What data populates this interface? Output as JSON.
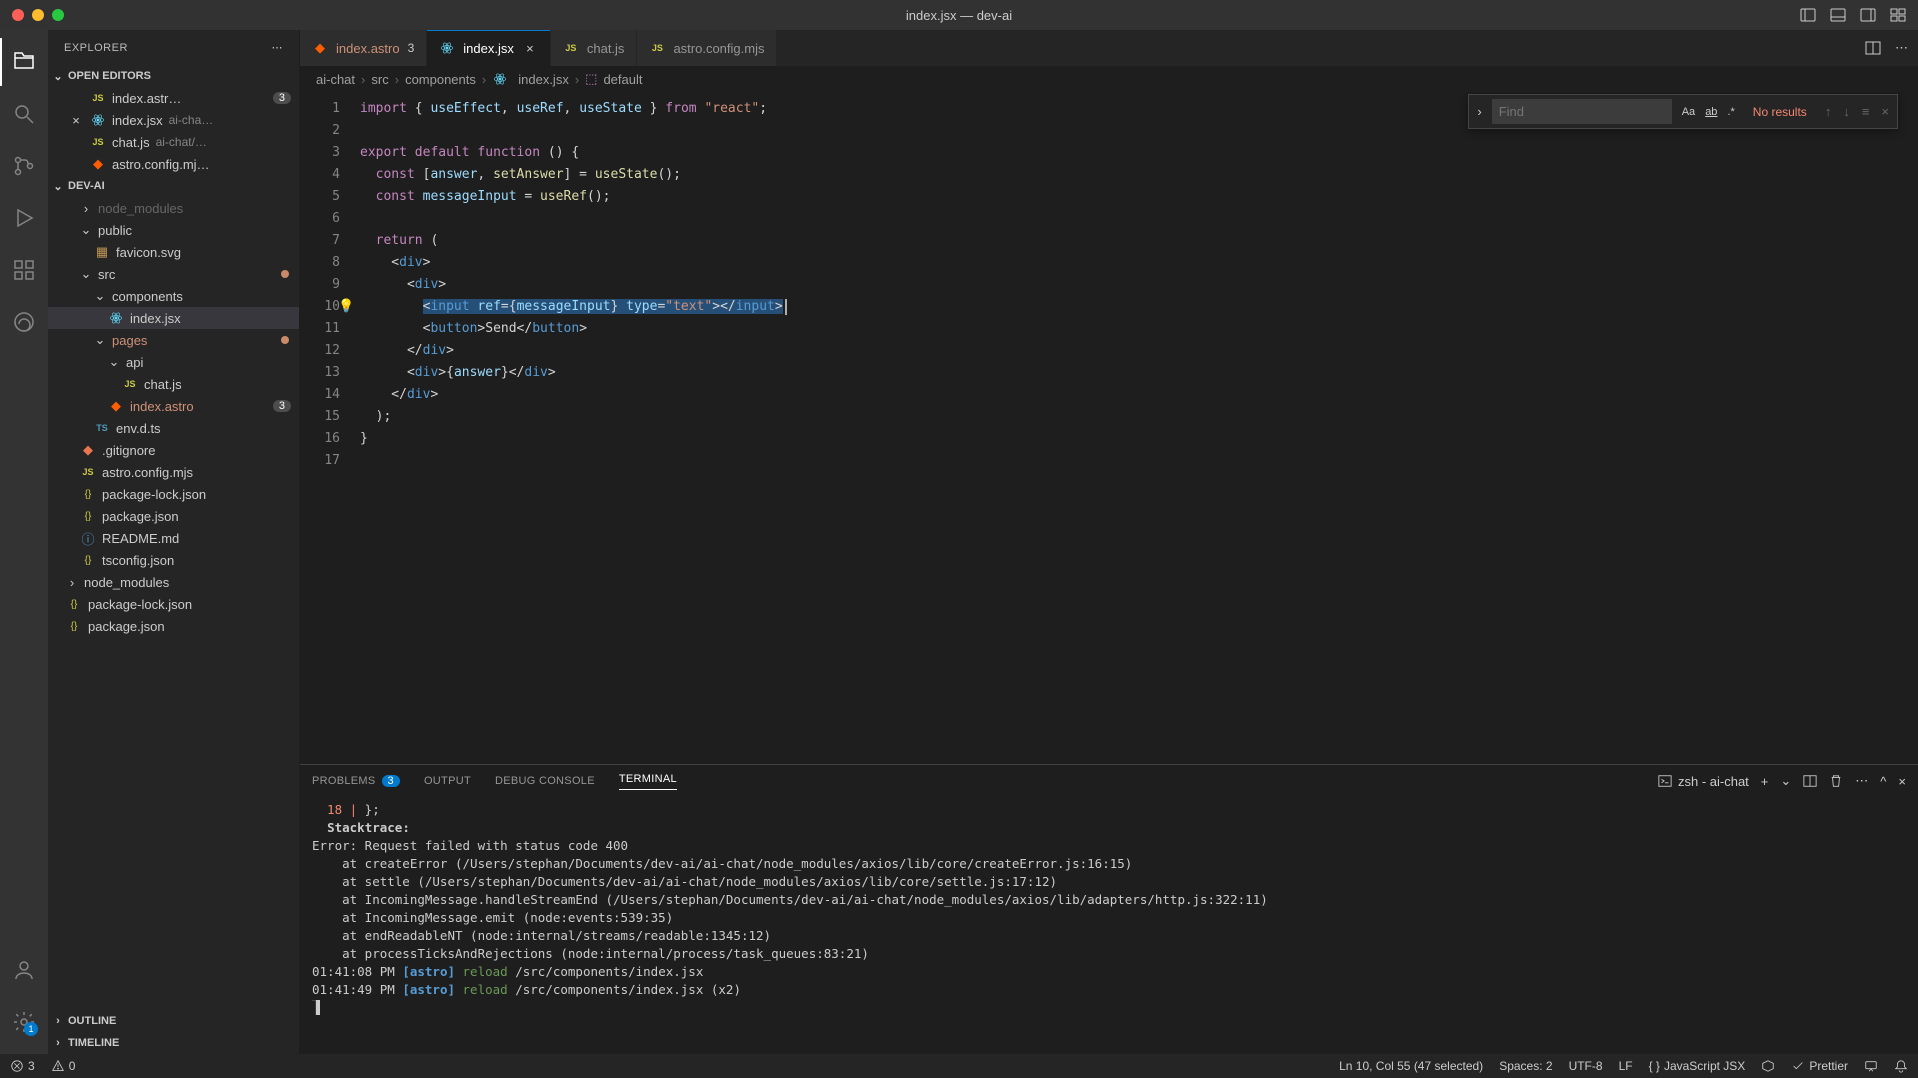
{
  "window": {
    "title": "index.jsx — dev-ai"
  },
  "sidebar": {
    "title": "EXPLORER",
    "sections": {
      "open_editors": "OPEN EDITORS",
      "project": "DEV-AI",
      "outline": "OUTLINE",
      "timeline": "TIMELINE"
    }
  },
  "open_editors": [
    {
      "name": "index.astr…",
      "badge": "3",
      "suffix": ""
    },
    {
      "name": "index.jsx",
      "suffix": "ai-cha…",
      "active": true
    },
    {
      "name": "chat.js",
      "suffix": "ai-chat/…"
    },
    {
      "name": "astro.config.mj…",
      "suffix": ""
    }
  ],
  "tree": [
    {
      "label": "node_modules",
      "indent": 1,
      "folder": true,
      "dim": true
    },
    {
      "label": "public",
      "indent": 1,
      "folder": true,
      "open": true
    },
    {
      "label": "favicon.svg",
      "indent": 2,
      "icon": "svg"
    },
    {
      "label": "src",
      "indent": 1,
      "folder": true,
      "open": true,
      "mod": true
    },
    {
      "label": "components",
      "indent": 2,
      "folder": true,
      "open": true
    },
    {
      "label": "index.jsx",
      "indent": 3,
      "icon": "react",
      "selected": true
    },
    {
      "label": "pages",
      "indent": 2,
      "folder": true,
      "open": true,
      "mod": true,
      "orange": true
    },
    {
      "label": "api",
      "indent": 3,
      "folder": true,
      "open": true
    },
    {
      "label": "chat.js",
      "indent": 4,
      "icon": "js"
    },
    {
      "label": "index.astro",
      "indent": 3,
      "icon": "astro",
      "badge": "3",
      "orange": true
    },
    {
      "label": "env.d.ts",
      "indent": 2,
      "icon": "ts"
    },
    {
      "label": ".gitignore",
      "indent": 1,
      "icon": "git"
    },
    {
      "label": "astro.config.mjs",
      "indent": 1,
      "icon": "js"
    },
    {
      "label": "package-lock.json",
      "indent": 1,
      "icon": "json"
    },
    {
      "label": "package.json",
      "indent": 1,
      "icon": "json"
    },
    {
      "label": "README.md",
      "indent": 1,
      "icon": "md"
    },
    {
      "label": "tsconfig.json",
      "indent": 1,
      "icon": "json"
    },
    {
      "label": "node_modules",
      "indent": 0,
      "folder": true
    },
    {
      "label": "package-lock.json",
      "indent": 0,
      "icon": "json"
    },
    {
      "label": "package.json",
      "indent": 0,
      "icon": "json"
    }
  ],
  "tabs": [
    {
      "label": "index.astro",
      "icon": "astro",
      "badge": "3"
    },
    {
      "label": "index.jsx",
      "icon": "react",
      "active": true,
      "close": "×"
    },
    {
      "label": "chat.js",
      "icon": "js"
    },
    {
      "label": "astro.config.mjs",
      "icon": "js"
    }
  ],
  "breadcrumbs": [
    "ai-chat",
    "src",
    "components",
    "index.jsx",
    "default"
  ],
  "find": {
    "placeholder": "Find",
    "results": "No results"
  },
  "code": {
    "lines": 17,
    "content": {
      "l1": "import { useEffect, useRef, useState } from \"react\";",
      "l2": "",
      "l3": "export default function () {",
      "l4": "  const [answer, setAnswer] = useState();",
      "l5": "  const messageInput = useRef();",
      "l6": "",
      "l7": "  return (",
      "l8": "    <div>",
      "l9": "      <div>",
      "l10_pre": "        ",
      "l10_sel": "<input ref={messageInput} type=\"text\"></input>",
      "l11": "        <button>Send</button>",
      "l12": "      </div>",
      "l13": "      <div>{answer}</div>",
      "l14": "    </div>",
      "l15": "  );",
      "l16": "}",
      "l17": ""
    }
  },
  "panel": {
    "tabs": {
      "problems": "PROBLEMS",
      "problems_badge": "3",
      "output": "OUTPUT",
      "debug": "DEBUG CONSOLE",
      "terminal": "TERMINAL"
    },
    "shell": "zsh - ai-chat"
  },
  "terminal": {
    "lines": [
      "  18 | };",
      "  Stacktrace:",
      "Error: Request failed with status code 400",
      "    at createError (/Users/stephan/Documents/dev-ai/ai-chat/node_modules/axios/lib/core/createError.js:16:15)",
      "    at settle (/Users/stephan/Documents/dev-ai/ai-chat/node_modules/axios/lib/core/settle.js:17:12)",
      "    at IncomingMessage.handleStreamEnd (/Users/stephan/Documents/dev-ai/ai-chat/node_modules/axios/lib/adapters/http.js:322:11)",
      "    at IncomingMessage.emit (node:events:539:35)",
      "    at endReadableNT (node:internal/streams/readable:1345:12)",
      "    at processTicksAndRejections (node:internal/process/task_queues:83:21)",
      "",
      "01:41:08 PM [astro] reload /src/components/index.jsx",
      "01:41:49 PM [astro] reload /src/components/index.jsx (x2)"
    ]
  },
  "statusbar": {
    "errors": "3",
    "warnings": "0",
    "cursor": "Ln 10, Col 55 (47 selected)",
    "spaces": "Spaces: 2",
    "encoding": "UTF-8",
    "eol": "LF",
    "lang": "JavaScript JSX",
    "prettier": "Prettier"
  }
}
